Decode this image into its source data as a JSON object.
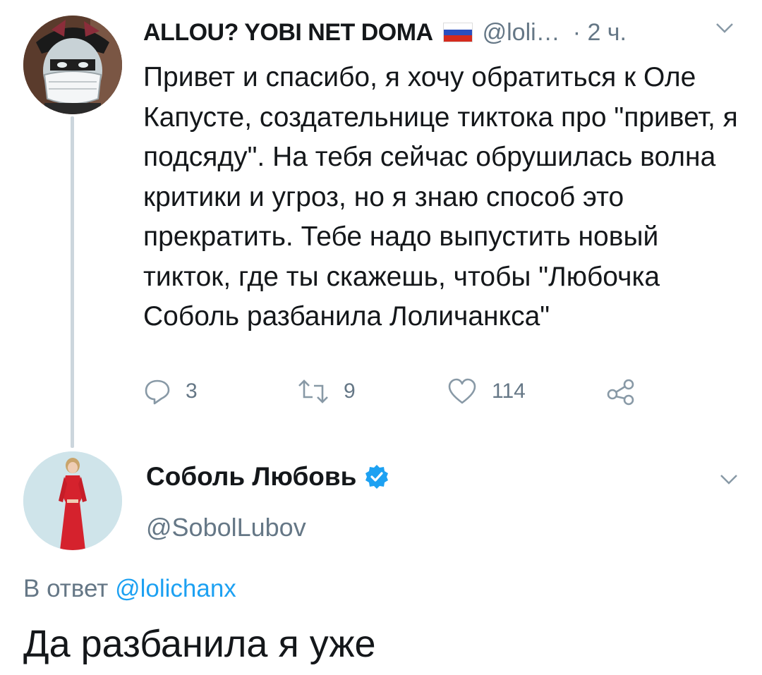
{
  "tweet1": {
    "display_name": "ALLOU? YOBI NET DOMA",
    "flag_icon": "russia-flag-icon",
    "handle": "@loli…",
    "time": "· 2 ч.",
    "text": "Привет и спасибо, я хочу обратиться к Оле Капусте, создательнице тиктока про \"привет, я подсяду\". На тебя сейчас обрушилась волна критики и угроз, но я знаю способ это прекратить. Тебе надо выпустить новый тикток, где ты скажешь, чтобы \"Любочка Соболь разбанила Лоличанкса\"",
    "actions": {
      "reply_count": "3",
      "retweet_count": "9",
      "like_count": "114"
    }
  },
  "tweet2": {
    "display_name": "Соболь Любовь",
    "verified_icon": "verified-badge-icon",
    "handle": "@SobolLubov",
    "reply_prefix": "В ответ",
    "reply_handle": "@lolichanx",
    "text": "Да разбанила я уже"
  },
  "colors": {
    "text": "#14171a",
    "secondary": "#657786",
    "link": "#1da1f2",
    "thread_line": "#ccd6dd"
  }
}
